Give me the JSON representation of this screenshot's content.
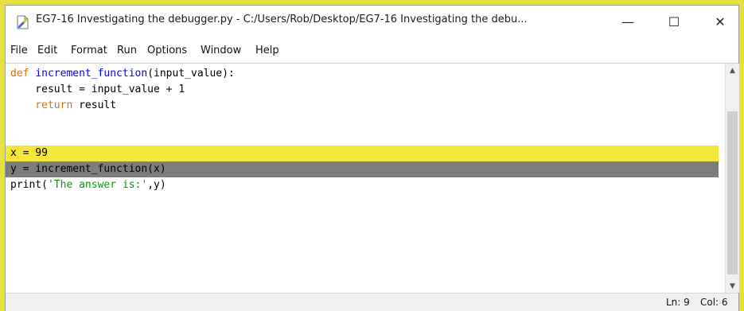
{
  "window": {
    "title": "EG7-16 Investigating the debugger.py - C:/Users/Rob/Desktop/EG7-16 Investigating the debu...",
    "minimize_label": "—",
    "maximize_label": "☐",
    "close_label": "✕"
  },
  "menu": {
    "items": [
      "File",
      "Edit",
      "Format",
      "Run",
      "Options",
      "Window",
      "Help"
    ]
  },
  "code": {
    "line1": {
      "kw": "def",
      "fn": "increment_function",
      "rest": "(input_value):"
    },
    "line2": {
      "text": "    result = input_value + 1"
    },
    "line3": {
      "kw": "    return",
      "rest": " result"
    },
    "line6": {
      "text": "x = 99"
    },
    "line7": {
      "text": "y = increment_function(x)"
    },
    "line8": {
      "pre": "print(",
      "str": "'The answer is:'",
      "post": ",y)"
    }
  },
  "status": {
    "line": "Ln: 9",
    "col": "Col: 6"
  },
  "colors": {
    "outer_background": "#e8e040",
    "current_line_highlight": "#f5e63c",
    "breakpoint_line_highlight": "#7d7d7d",
    "keyword": "#e07000",
    "builtin": "#0000ff",
    "string": "#00a000"
  },
  "icons": {
    "app": "python-idle-icon",
    "scroll_up": "scroll-up-arrow-icon",
    "scroll_down": "scroll-down-arrow-icon"
  }
}
